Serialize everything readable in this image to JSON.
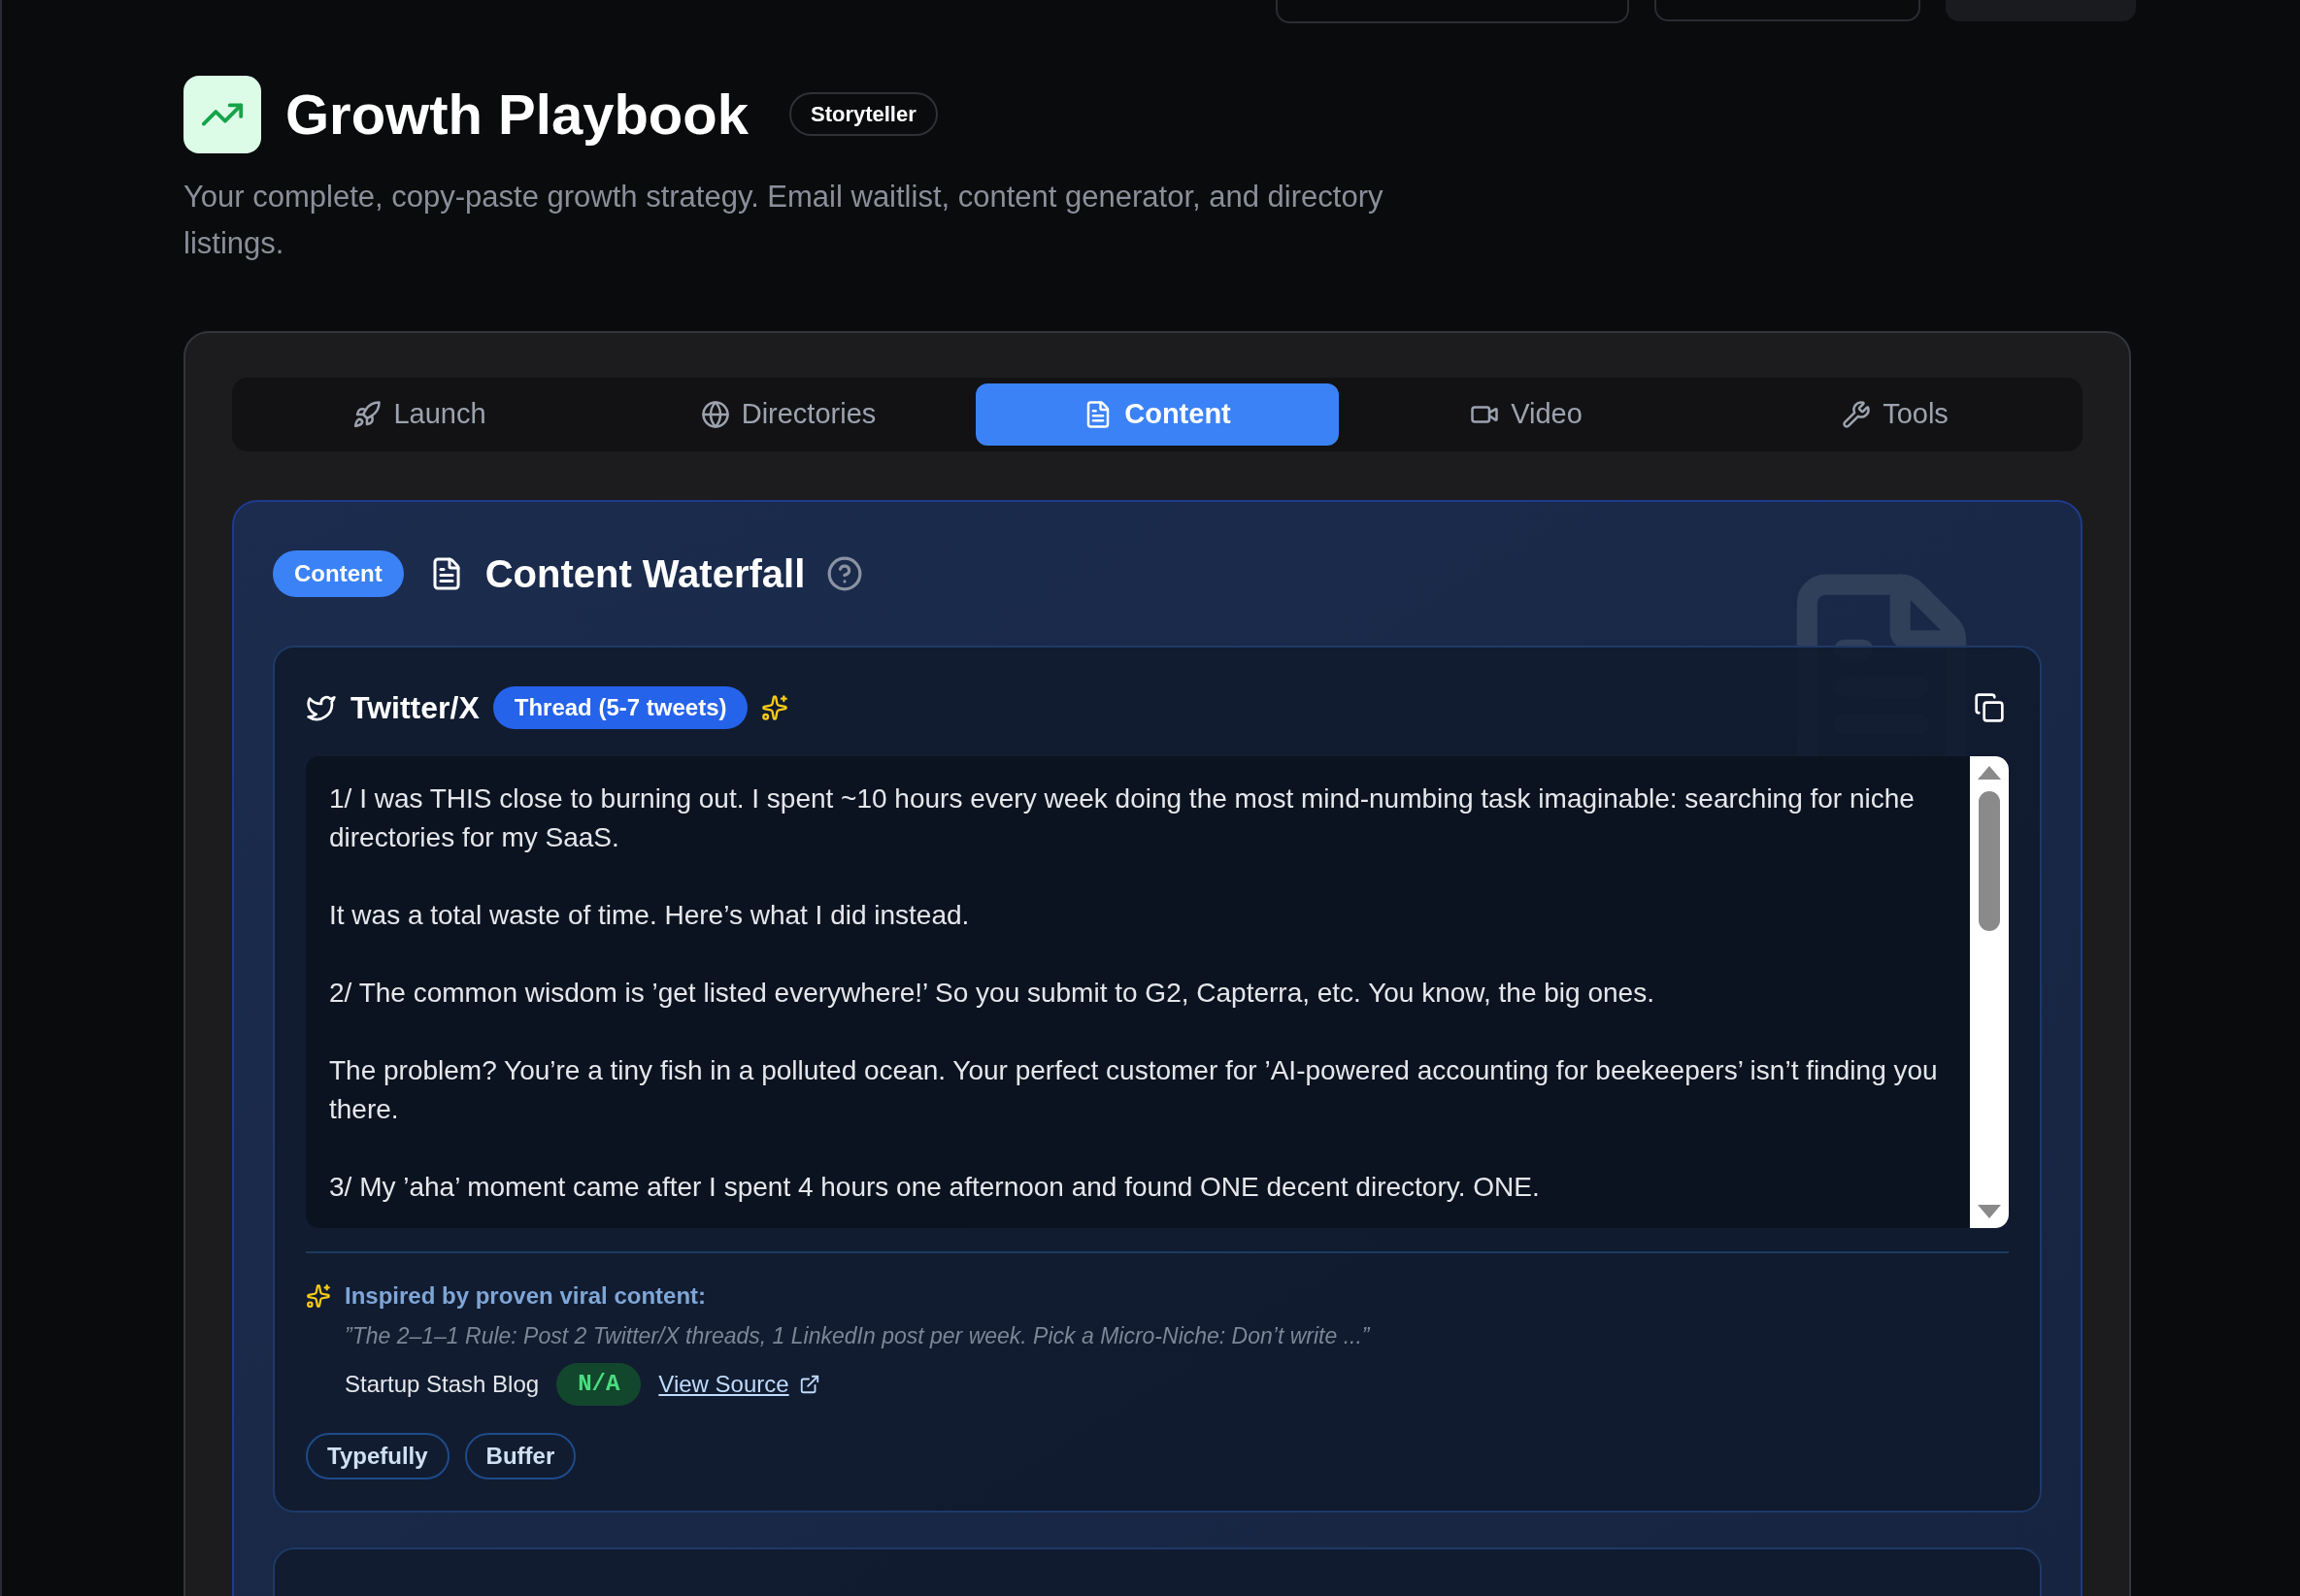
{
  "header": {
    "title": "Growth Playbook",
    "badge": "Storyteller",
    "description": "Your complete, copy-paste growth strategy. Email waitlist, content generator, and directory listings."
  },
  "tabs": [
    {
      "label": "Launch",
      "selected": false
    },
    {
      "label": "Directories",
      "selected": false
    },
    {
      "label": "Content",
      "selected": true
    },
    {
      "label": "Video",
      "selected": false
    },
    {
      "label": "Tools",
      "selected": false
    }
  ],
  "section": {
    "badge": "Content",
    "title": "Content Waterfall"
  },
  "cards": [
    {
      "platform": "Twitter/X",
      "format": "Thread (5-7 tweets)",
      "paragraphs": [
        "1/ I was THIS close to burning out. I spent ~10 hours every week doing the most mind-numbing task imaginable: searching for niche directories for my SaaS.",
        "It was a total waste of time. Here’s what I did instead.",
        "2/ The common wisdom is ’get listed everywhere!’ So you submit to G2, Capterra, etc. You know, the big ones.",
        "The problem? You’re a tiny fish in a polluted ocean. Your perfect customer for ’AI-powered accounting for beekeepers’ isn’t finding you there.",
        "3/ My ’aha’ moment came after I spent 4 hours one afternoon and found ONE decent directory. ONE."
      ],
      "inspiration": {
        "heading": "Inspired by proven viral content:",
        "quote": "”The 2–1–1 Rule: Post 2 Twitter/X threads, 1 LinkedIn post per week. Pick a Micro-Niche: Don’t write ...”",
        "source": "Startup Stash Blog",
        "score": "N/A",
        "link": "View Source"
      },
      "tools": [
        "Typefully",
        "Buffer"
      ]
    }
  ]
}
